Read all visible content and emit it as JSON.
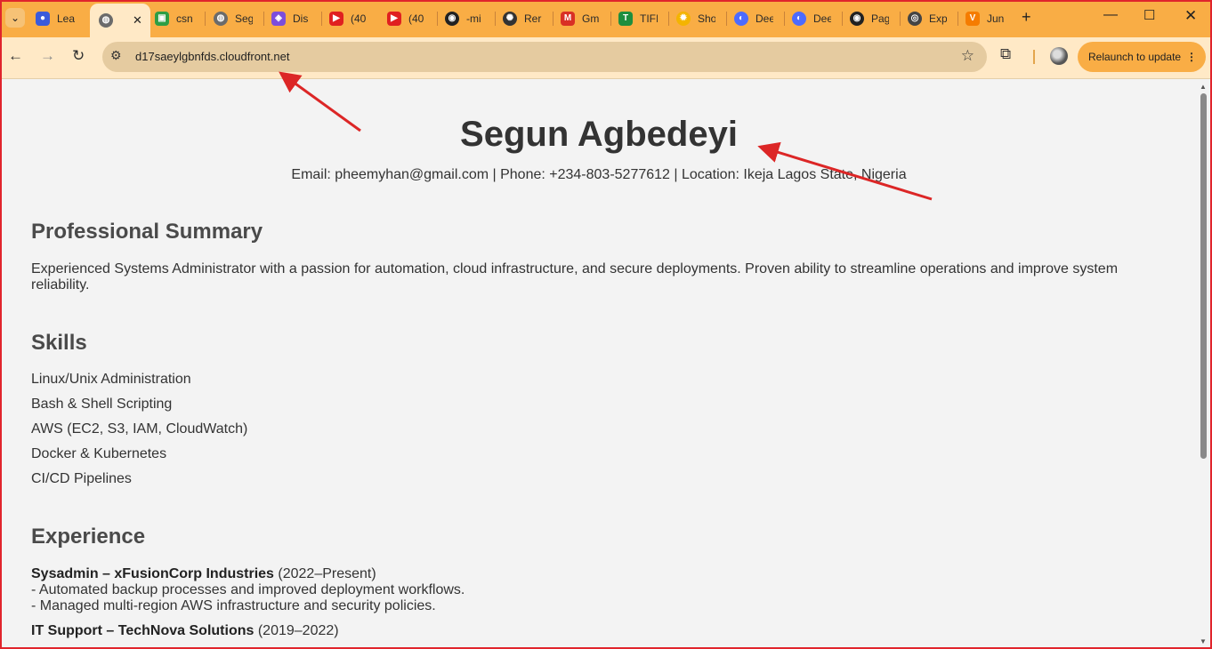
{
  "browser": {
    "tabs": [
      {
        "label": "Lea",
        "favicon_color": "#3b5bdb",
        "favicon_glyph": "●"
      },
      {
        "label": "",
        "favicon_color": "#6b6b6b",
        "favicon_glyph": "◍",
        "active": true
      },
      {
        "label": "csn",
        "favicon_color": "#2e9e44",
        "favicon_glyph": "▣"
      },
      {
        "label": "Seg",
        "favicon_color": "#6b6b6b",
        "favicon_glyph": "◍"
      },
      {
        "label": "Dis",
        "favicon_color": "#7c4ddb",
        "favicon_glyph": "◈"
      },
      {
        "label": "(40",
        "favicon_color": "#e02020",
        "favicon_glyph": "▶"
      },
      {
        "label": "(40",
        "favicon_color": "#e02020",
        "favicon_glyph": "▶"
      },
      {
        "label": "-mi",
        "favicon_color": "#222222",
        "favicon_glyph": "◉"
      },
      {
        "label": "Rer",
        "favicon_color": "#333333",
        "favicon_glyph": "✺"
      },
      {
        "label": "Gm",
        "favicon_color": "#d93025",
        "favicon_glyph": "M"
      },
      {
        "label": "TIFI",
        "favicon_color": "#1e8e3e",
        "favicon_glyph": "T"
      },
      {
        "label": "Sho",
        "favicon_color": "#f4b400",
        "favicon_glyph": "✹"
      },
      {
        "label": "Dee",
        "favicon_color": "#4d6bfe",
        "favicon_glyph": "◐"
      },
      {
        "label": "Dee",
        "favicon_color": "#4d6bfe",
        "favicon_glyph": "◐"
      },
      {
        "label": "Pag",
        "favicon_color": "#222222",
        "favicon_glyph": "◉"
      },
      {
        "label": "Exp",
        "favicon_color": "#444444",
        "favicon_glyph": "◎"
      },
      {
        "label": "Jun",
        "favicon_color": "#f57c00",
        "favicon_glyph": "V"
      }
    ],
    "url": "d17saeylgbnfds.cloudfront.net",
    "relaunch_label": "Relaunch to update"
  },
  "resume": {
    "name": "Segun Agbedeyi",
    "contact": "Email: pheemyhan@gmail.com | Phone: +234-803-5277612 | Location: Ikeja Lagos State, Nigeria",
    "summary_heading": "Professional Summary",
    "summary": "Experienced Systems Administrator with a passion for automation, cloud infrastructure, and secure deployments. Proven ability to streamline operations and improve system reliability.",
    "skills_heading": "Skills",
    "skills": [
      "Linux/Unix Administration",
      "Bash & Shell Scripting",
      "AWS (EC2, S3, IAM, CloudWatch)",
      "Docker & Kubernetes",
      "CI/CD Pipelines"
    ],
    "experience_heading": "Experience",
    "jobs": [
      {
        "title": "Sysadmin – xFusionCorp Industries",
        "period": "(2022–Present)",
        "bullets": [
          "- Automated backup processes and improved deployment workflows.",
          "- Managed multi-region AWS infrastructure and security policies."
        ]
      },
      {
        "title": "IT Support – TechNova Solutions",
        "period": "(2019–2022)",
        "bullets": []
      }
    ]
  },
  "annotation": {
    "arrow_color": "#dc2626"
  }
}
